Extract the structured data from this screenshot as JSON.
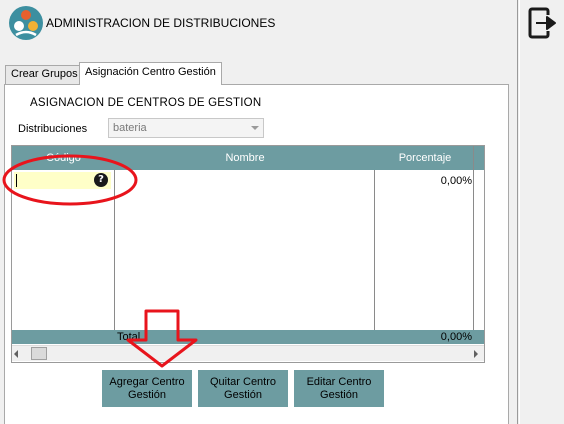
{
  "header": {
    "title": "ADMINISTRACION DE DISTRIBUCIONES",
    "logo_icon": "app-logo-icon"
  },
  "side_panel": {
    "exit_icon": "exit-icon"
  },
  "tabs": [
    {
      "label": "Crear Grupos",
      "active": false
    },
    {
      "label": "Asignación Centro Gestión",
      "active": true
    }
  ],
  "panel": {
    "section_title": "ASIGNACION DE CENTROS DE GESTION",
    "distribuciones_label": "Distribuciones",
    "distribuciones_value": "bateria"
  },
  "grid": {
    "columns": [
      "Código",
      "Nombre",
      "Porcentaje"
    ],
    "rows": [
      {
        "codigo": "",
        "nombre": "",
        "porcentaje": "0,00%"
      }
    ],
    "footer_label": "Total",
    "footer_value": "0,00%",
    "help_glyph": "?"
  },
  "buttons": {
    "agregar": "Agregar Centro Gestión",
    "quitar": "Quitar Centro Gestión",
    "editar": "Editar Centro Gestión"
  },
  "colors": {
    "header_teal": "#6d9ca1",
    "annotation_red": "#e8141c",
    "input_highlight": "#ffffc8"
  }
}
